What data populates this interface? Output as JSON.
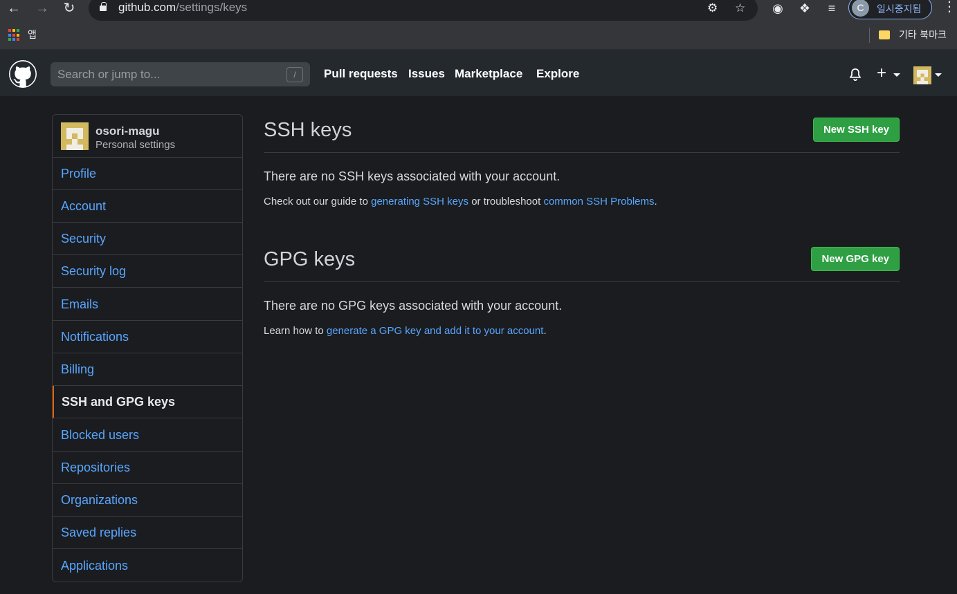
{
  "browser": {
    "url_host": "github.com",
    "url_path": "/settings/keys",
    "profile_initial": "C",
    "profile_status": "일시중지됨",
    "apps_label": "앱",
    "other_bookmarks": "기타 북마크"
  },
  "header": {
    "search_placeholder": "Search or jump to...",
    "search_shortcut": "/",
    "nav": [
      "Pull requests",
      "Issues",
      "Marketplace",
      "Explore"
    ],
    "plus_symbol": "+"
  },
  "sidebar": {
    "username": "osori-magu",
    "subtitle": "Personal settings",
    "items": [
      {
        "label": "Profile"
      },
      {
        "label": "Account"
      },
      {
        "label": "Security"
      },
      {
        "label": "Security log"
      },
      {
        "label": "Emails"
      },
      {
        "label": "Notifications"
      },
      {
        "label": "Billing"
      },
      {
        "label": "SSH and GPG keys",
        "active": true
      },
      {
        "label": "Blocked users"
      },
      {
        "label": "Repositories"
      },
      {
        "label": "Organizations"
      },
      {
        "label": "Saved replies"
      },
      {
        "label": "Applications"
      }
    ]
  },
  "ssh": {
    "title": "SSH keys",
    "button": "New SSH key",
    "empty": "There are no SSH keys associated with your account.",
    "note_prefix": "Check out our guide to ",
    "note_link1": "generating SSH keys",
    "note_middle": " or troubleshoot ",
    "note_link2": "common SSH Problems",
    "note_suffix": "."
  },
  "gpg": {
    "title": "GPG keys",
    "button": "New GPG key",
    "empty": "There are no GPG keys associated with your account.",
    "note_prefix": "Learn how to ",
    "note_link": "generate a GPG key and add it to your account",
    "note_suffix": "."
  },
  "colors": {
    "accent_link": "#58a6ff",
    "button_green": "#2ea043",
    "active_indicator": "#e36209",
    "header_bg": "#24292e",
    "page_bg": "#1b1c1f"
  }
}
